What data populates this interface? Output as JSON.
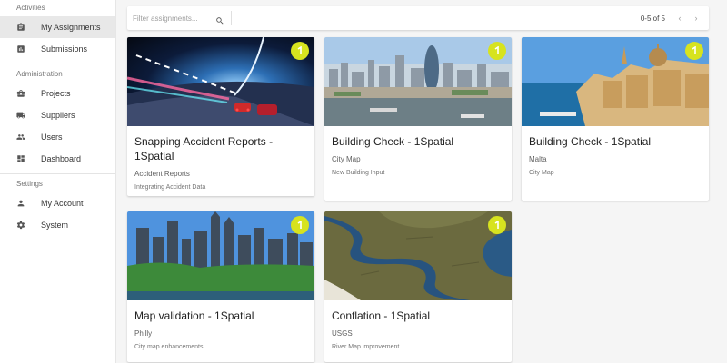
{
  "sidebar": {
    "sections": [
      {
        "label": "Activities",
        "items": [
          {
            "label": "My Assignments",
            "icon": "clipboard-icon",
            "active": true
          },
          {
            "label": "Submissions",
            "icon": "bar-chart-icon",
            "active": false
          }
        ]
      },
      {
        "label": "Administration",
        "items": [
          {
            "label": "Projects",
            "icon": "briefcase-icon",
            "active": false
          },
          {
            "label": "Suppliers",
            "icon": "truck-icon",
            "active": false
          },
          {
            "label": "Users",
            "icon": "people-icon",
            "active": false
          },
          {
            "label": "Dashboard",
            "icon": "dashboard-icon",
            "active": false
          }
        ]
      },
      {
        "label": "Settings",
        "items": [
          {
            "label": "My Account",
            "icon": "person-icon",
            "active": false
          },
          {
            "label": "System",
            "icon": "gear-icon",
            "active": false
          }
        ]
      }
    ]
  },
  "toolbar": {
    "filter_placeholder": "Filter assignments...",
    "filter_value": "",
    "pagination_label": "0-5 of 5",
    "prev_label": "‹",
    "next_label": "›"
  },
  "cards": [
    {
      "title": "Snapping Accident Reports - 1Spatial",
      "subtitle": "Accident Reports",
      "description": "Integrating Accident Data",
      "image": "tunnel"
    },
    {
      "title": "Building Check - 1Spatial",
      "subtitle": "City Map",
      "description": "New Building Input",
      "image": "london"
    },
    {
      "title": "Building Check - 1Spatial",
      "subtitle": "Malta",
      "description": "City Map",
      "image": "malta"
    },
    {
      "title": "Map validation - 1Spatial",
      "subtitle": "Philly",
      "description": "City map enhancements",
      "image": "philly"
    },
    {
      "title": "Conflation - 1Spatial",
      "subtitle": "USGS",
      "description": "River Map improvement",
      "image": "river"
    }
  ],
  "colors": {
    "brand_badge": "#d7e31f",
    "active_nav": "#e8e8e8",
    "background": "#f5f5f5"
  }
}
